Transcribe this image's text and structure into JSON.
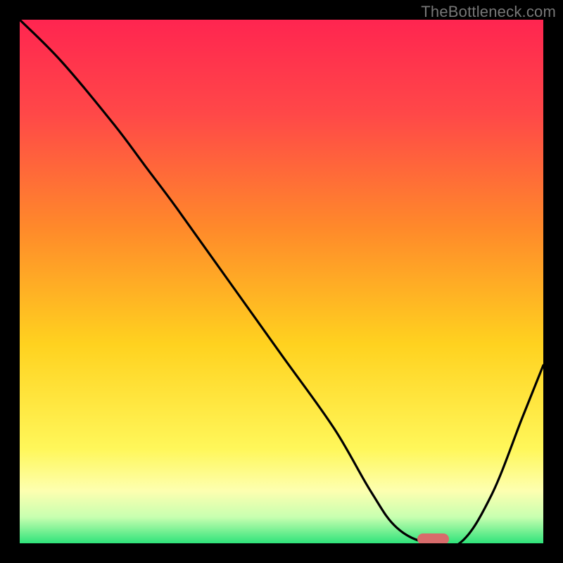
{
  "watermark": "TheBottleneck.com",
  "colors": {
    "frame": "#000000",
    "curve": "#000000",
    "marker": "#d86b6b",
    "gradient_stops": [
      {
        "offset": 0.0,
        "color": "#ff2550"
      },
      {
        "offset": 0.18,
        "color": "#ff4848"
      },
      {
        "offset": 0.4,
        "color": "#ff8a2a"
      },
      {
        "offset": 0.62,
        "color": "#ffd21f"
      },
      {
        "offset": 0.82,
        "color": "#fff75a"
      },
      {
        "offset": 0.9,
        "color": "#fdffb0"
      },
      {
        "offset": 0.95,
        "color": "#c8ffb0"
      },
      {
        "offset": 1.0,
        "color": "#2fe37a"
      }
    ]
  },
  "chart_data": {
    "type": "line",
    "title": "",
    "xlabel": "",
    "ylabel": "",
    "xlim": [
      0,
      100
    ],
    "ylim": [
      0,
      100
    ],
    "series": [
      {
        "name": "bottleneck-curve",
        "x": [
          0,
          8,
          18,
          24,
          30,
          40,
          50,
          60,
          67,
          72,
          78,
          84,
          90,
          96,
          100
        ],
        "y": [
          100,
          92,
          80,
          72,
          64,
          50,
          36,
          22,
          10,
          3,
          0,
          0,
          9,
          24,
          34
        ]
      }
    ],
    "marker": {
      "x_start": 76,
      "x_end": 82,
      "y": 0
    },
    "annotations": []
  }
}
